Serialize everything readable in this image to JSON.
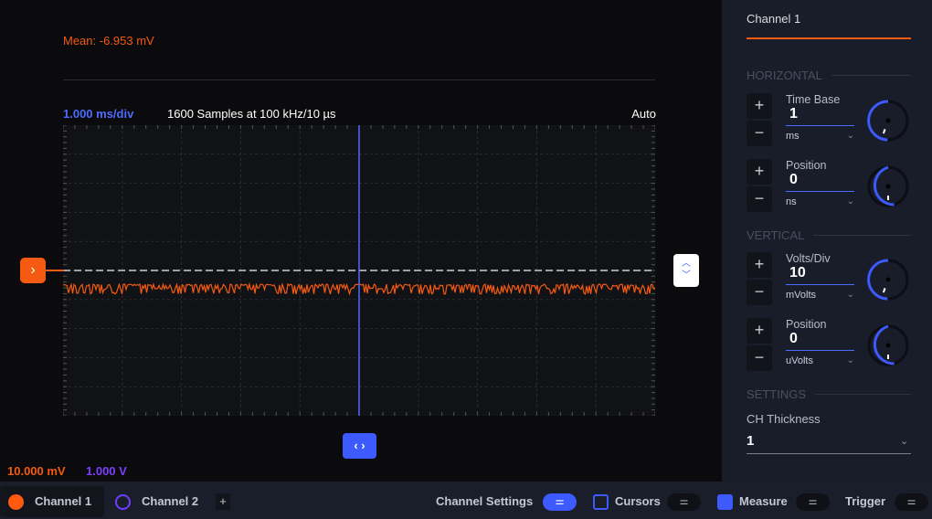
{
  "scope": {
    "mean": "Mean: -6.953 mV",
    "time_div": "1.000 ms/div",
    "samples": "1600 Samples at 100 kHz/10 µs",
    "mode": "Auto",
    "ch1_scale": "10.000 mV",
    "ch2_scale": "1.000 V",
    "ch1_color": "#f45a12",
    "ch2_color": "#6e3dff",
    "accent": "#3d5afe"
  },
  "panel": {
    "title": "Channel 1",
    "horizontal": {
      "label": "HORIZONTAL",
      "time_base": {
        "label": "Time Base",
        "value": "1",
        "unit": "ms"
      },
      "position": {
        "label": "Position",
        "value": "0",
        "unit": "ns"
      }
    },
    "vertical": {
      "label": "VERTICAL",
      "volts_div": {
        "label": "Volts/Div",
        "value": "10",
        "unit": "mVolts"
      },
      "position": {
        "label": "Position",
        "value": "0",
        "unit": "uVolts"
      }
    },
    "settings": {
      "label": "SETTINGS",
      "ch_thickness": {
        "label": "CH Thickness",
        "value": "1"
      }
    }
  },
  "bottom": {
    "channel1": "Channel 1",
    "channel2": "Channel 2",
    "add": "+",
    "channel_settings": "Channel Settings",
    "cursors": "Cursors",
    "measure": "Measure",
    "trigger": "Trigger"
  },
  "icons": {
    "plus": "+",
    "minus": "−",
    "chevron": "⌄",
    "arrow_right": "›",
    "updown": "⌃⌄",
    "leftright": "‹ ›",
    "sliders": "⚌"
  }
}
